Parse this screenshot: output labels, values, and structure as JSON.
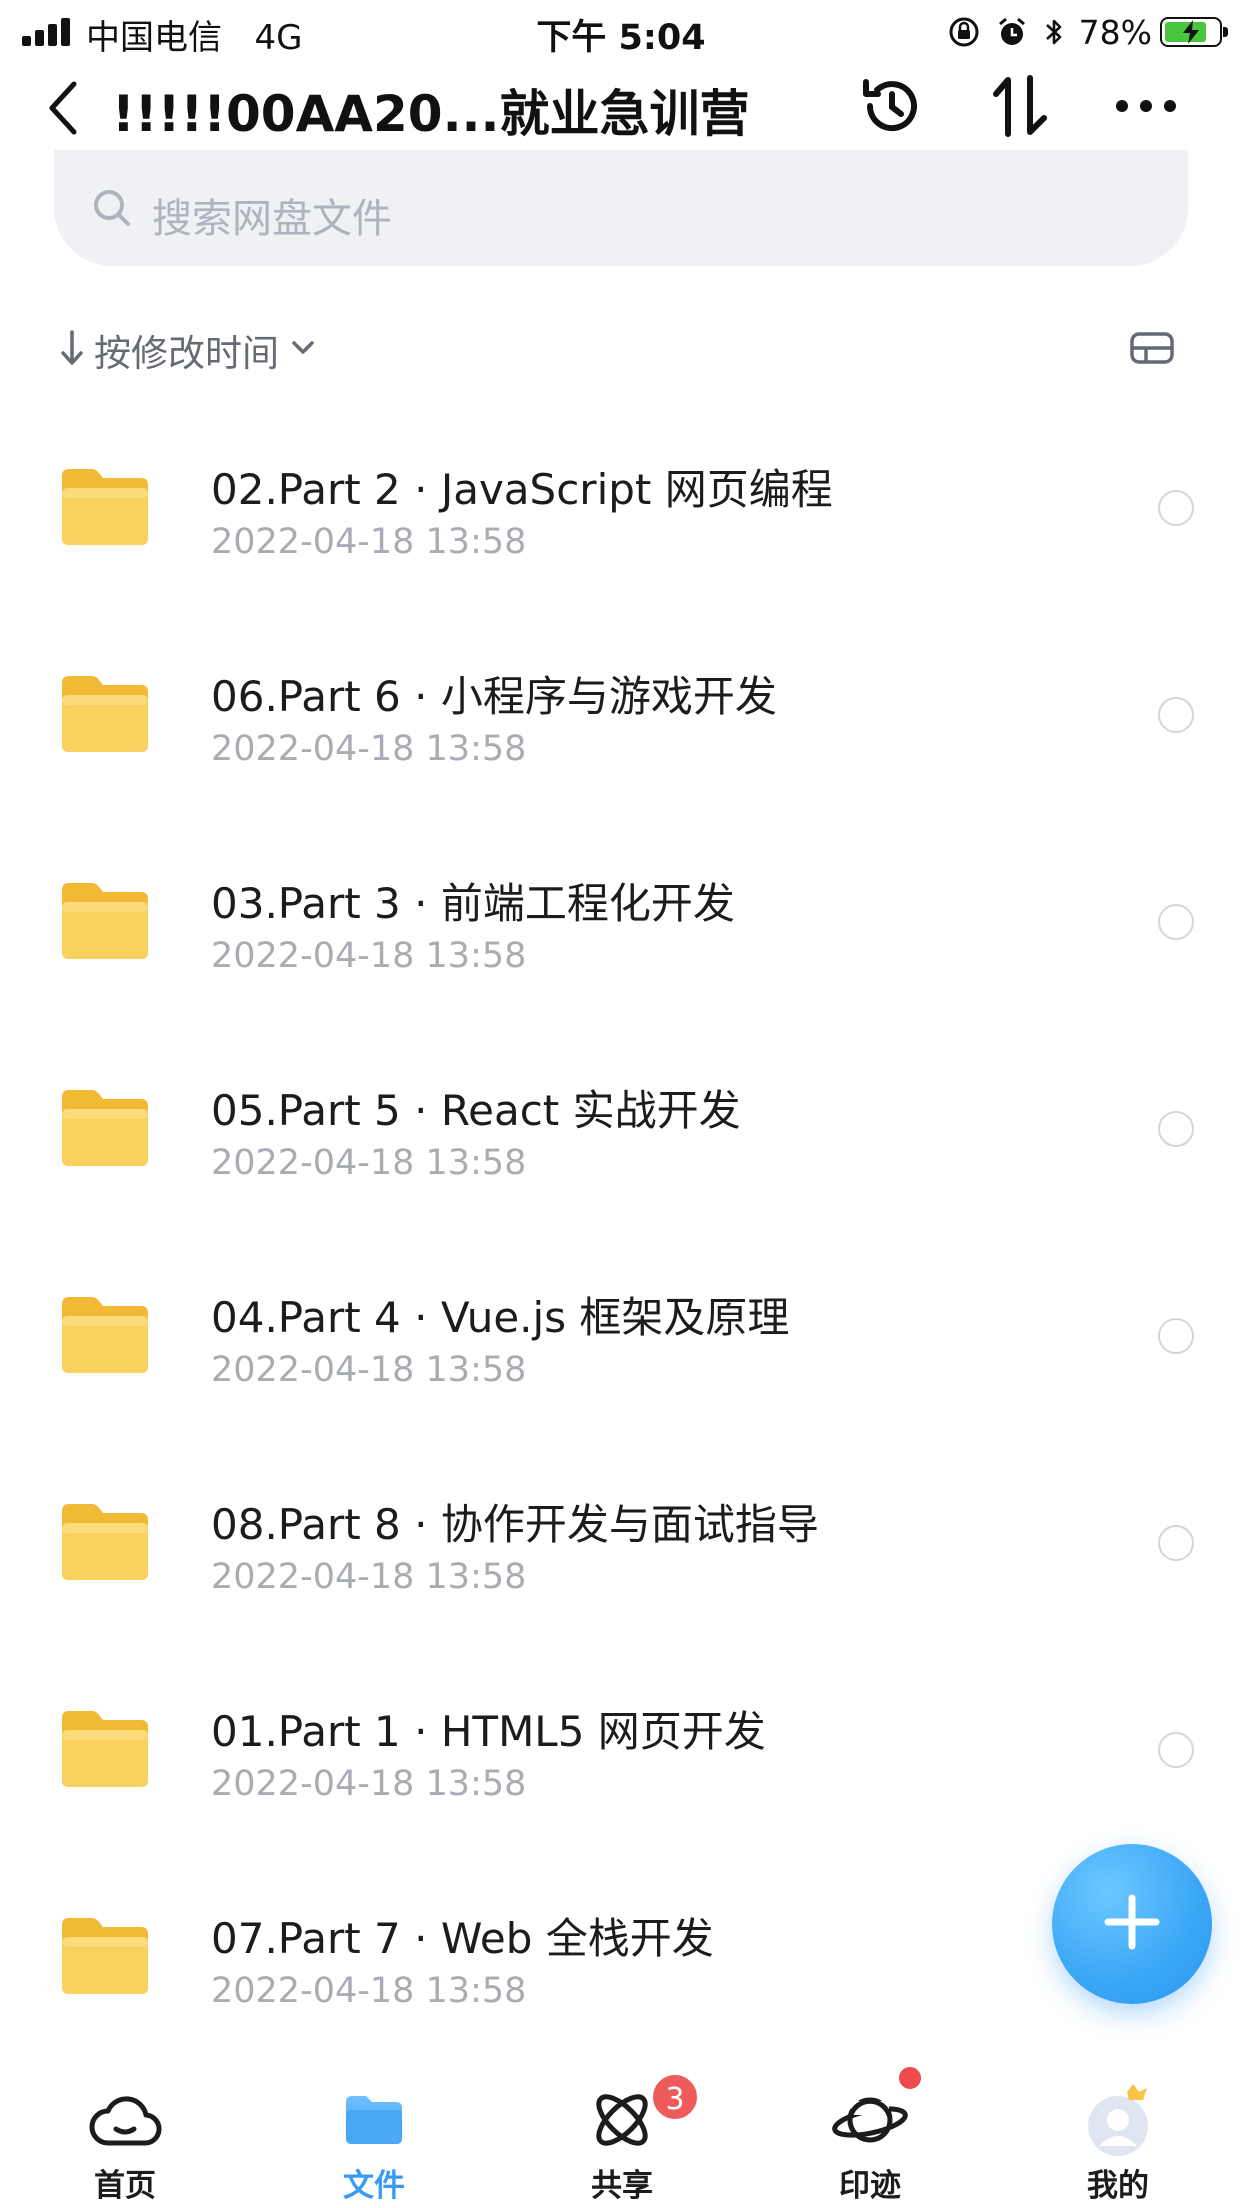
{
  "status_bar": {
    "carrier": "中国电信",
    "network": "4G",
    "time": "下午 5:04",
    "battery_percent": "78%",
    "battery_level": 0.78,
    "icons": [
      "signal-icon",
      "orientation-lock-icon",
      "alarm-icon",
      "bluetooth-icon",
      "battery-charging-icon"
    ]
  },
  "nav": {
    "title": "!!!!!00AA20...就业急训营",
    "actions": [
      "history-icon",
      "sort-swap-icon",
      "more-icon"
    ]
  },
  "search": {
    "placeholder": "搜索网盘文件"
  },
  "sort": {
    "label": "按修改时间"
  },
  "files": [
    {
      "name": "02.Part 2 · JavaScript 网页编程",
      "date": "2022-04-18 13:58"
    },
    {
      "name": "06.Part 6 · 小程序与游戏开发",
      "date": "2022-04-18 13:58"
    },
    {
      "name": "03.Part 3 · 前端工程化开发",
      "date": "2022-04-18 13:58"
    },
    {
      "name": "05.Part 5 · React 实战开发",
      "date": "2022-04-18 13:58"
    },
    {
      "name": "04.Part 4 · Vue.js 框架及原理",
      "date": "2022-04-18 13:58"
    },
    {
      "name": "08.Part 8 · 协作开发与面试指导",
      "date": "2022-04-18 13:58"
    },
    {
      "name": "01.Part 1 · HTML5 网页开发",
      "date": "2022-04-18 13:58"
    },
    {
      "name": "07.Part 7 · Web 全栈开发",
      "date": "2022-04-18 13:58"
    }
  ],
  "tabs": [
    {
      "label": "首页",
      "icon": "cloud-icon"
    },
    {
      "label": "文件",
      "icon": "folder-icon",
      "active": true
    },
    {
      "label": "共享",
      "icon": "atom-icon",
      "badge": "3"
    },
    {
      "label": "印迹",
      "icon": "planet-icon",
      "dot": true
    },
    {
      "label": "我的",
      "icon": "avatar-icon"
    }
  ],
  "colors": {
    "accent": "#3a9bf4",
    "folder": "#f7c94a",
    "badge": "#ef5a5a"
  }
}
